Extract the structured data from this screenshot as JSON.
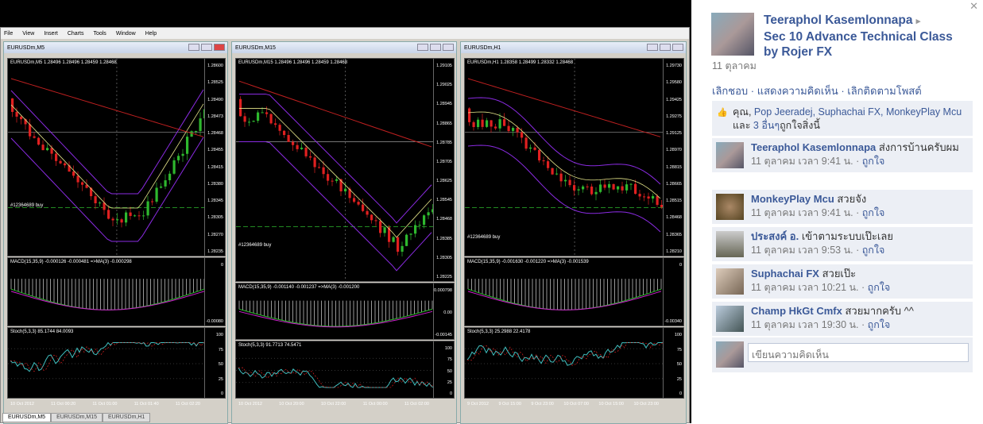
{
  "terminal": {
    "menu": [
      "File",
      "View",
      "Insert",
      "Charts",
      "Tools",
      "Window",
      "Help"
    ],
    "windows": [
      {
        "title": "EURUSDm,M5",
        "header": "EURUSDm,M5  1.28496 1.28496 1.28459 1.28468",
        "price_ticks": [
          "1.28600",
          "1.28525",
          "1.28490",
          "1.28473",
          "1.28468",
          "1.28455",
          "1.28415",
          "1.28380",
          "1.28345",
          "1.28305",
          "1.28270",
          "1.28235"
        ],
        "order": "#12364689 buy",
        "macd_label": "MACD(15,35,9) -0.000126 -0.000481 =>MA(3) -0.000298",
        "macd_ticks": [
          "0",
          "-0.00080"
        ],
        "stoch_label": "Stoch(5,3,3) 85.1744 84.0093",
        "stoch_ticks": [
          "100",
          "75",
          "50",
          "25",
          "0"
        ],
        "x_ticks": [
          "10 Oct 2012",
          "11 Oct 00:20",
          "11 Oct 01:00",
          "11 Oct 01:40",
          "11 Oct 02:20"
        ]
      },
      {
        "title": "EURUSDm,M15",
        "header": "EURUSDm,M15  1.28496 1.28496 1.28459 1.28468",
        "price_ticks": [
          "1.29105",
          "1.29025",
          "1.28945",
          "1.28865",
          "1.28785",
          "1.28705",
          "1.28625",
          "1.28545",
          "1.28468",
          "1.28385",
          "1.28305",
          "1.28225"
        ],
        "order": "#12364689 buy",
        "macd_label": "MACD(15,35,9) -0.001140 -0.001237 =>MA(3) -0.001200",
        "macd_ticks": [
          "0.000798",
          "0.00",
          "-0.00145"
        ],
        "stoch_label": "Stoch(5,3,3) 91.7713 74.5471",
        "stoch_ticks": [
          "100",
          "75",
          "50",
          "25",
          "0"
        ],
        "x_ticks": [
          "10 Oct 2012",
          "10 Oct 20:00",
          "10 Oct 22:00",
          "11 Oct 00:00",
          "11 Oct 02:00"
        ]
      },
      {
        "title": "EURUSDm,H1",
        "header": "EURUSDm,H1  1.28358 1.28499 1.28332 1.28468",
        "price_ticks": [
          "1.29730",
          "1.29580",
          "1.29425",
          "1.29275",
          "1.29125",
          "1.28970",
          "1.28815",
          "1.28665",
          "1.28515",
          "1.28468",
          "1.28365",
          "1.28210"
        ],
        "order": "#12364689 buy",
        "macd_label": "MACD(15,35,9) -0.001630 -0.001220 =>MA(3) -0.001539",
        "macd_ticks": [
          "0",
          "-0.00340"
        ],
        "stoch_label": "Stoch(5,3,3) 25.2988 22.4178",
        "stoch_ticks": [
          "100",
          "75",
          "50",
          "25",
          "0"
        ],
        "x_ticks": [
          "9 Oct 2012",
          "9 Oct 15:00",
          "9 Oct 23:00",
          "10 Oct 07:00",
          "10 Oct 15:00",
          "10 Oct 23:00"
        ]
      }
    ],
    "tabs": [
      "EURUSDm,M5",
      "EURUSDm,M15",
      "EURUSDm,H1"
    ]
  },
  "post": {
    "author": "Teeraphol Kasemlonnapa",
    "title": "Sec 10 Advance Technical Class by Rojer FX",
    "date": "11 ตุลาคม",
    "actions": "เลิกชอบ · แสดงความคิดเห็น · เลิกติดตามโพสต์",
    "likes_prefix": "คุณ, ",
    "likes_names": "Pop Jeeradej, Suphachai FX, MonkeyPlay Mcu",
    "likes_suffix": " และ ",
    "likes_others": "3 อื่นๆ",
    "likes_end": "ถูกใจสิ่งนี้"
  },
  "comments": [
    {
      "name": "Teeraphol Kasemlonnapa",
      "text": " ส่งการบ้านครับผม",
      "time": "11 ตุลาคม เวลา 9:41 น.",
      "like": "ถูกใจ"
    },
    {
      "name": "MonkeyPlay Mcu",
      "text": " สวยจัง",
      "time": "11 ตุลาคม เวลา 9:41 น.",
      "like": "ถูกใจ"
    },
    {
      "name": "ประสงค์ อ.",
      "text": " เข้าตามระบบเป๊ะเลย",
      "time": "11 ตุลาคม เวลา 9:53 น.",
      "like": "ถูกใจ"
    },
    {
      "name": "Suphachai FX",
      "text": " สวยเป๊ะ",
      "time": "11 ตุลาคม เวลา 10:21 น.",
      "like": "ถูกใจ"
    },
    {
      "name": "Champ HkGt Cmfx",
      "text": " สวยมากครับ ^^",
      "time": "11 ตุลาคม เวลา 19:30 น.",
      "like": "ถูกใจ"
    }
  ],
  "compose": {
    "placeholder": "เขียนความคิดเห็น"
  },
  "colors": {
    "fb_blue": "#3b5998",
    "bull": "#2eb82e",
    "bear": "#e02020",
    "signal": "#ff8000"
  }
}
